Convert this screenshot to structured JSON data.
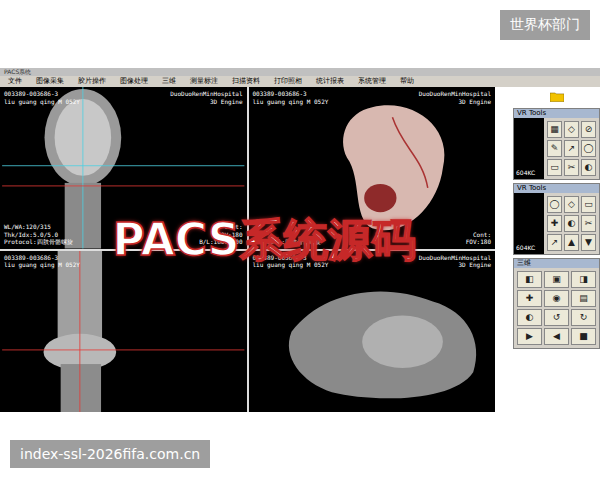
{
  "badge": "世界杯部门",
  "footer_url": "index-ssl-2026fifa.com.cn",
  "overlay_title": "PACS系统源码",
  "window": {
    "title": "PACS系统"
  },
  "menu": [
    "文件",
    "图像采集",
    "胶片操作",
    "图像处理",
    "三维",
    "测量标注",
    "扫描资料",
    "打印照相",
    "统计报表",
    "系统管理",
    "帮助"
  ],
  "viewports": [
    {
      "kind": "coronal",
      "top_left": [
        "003389-003686-3",
        "liu guang qing M 052Y"
      ],
      "top_right": [
        "DuoDuoRenMinHospital",
        "3D Engine"
      ],
      "bottom_left": [
        "WL/WA:120/315",
        "Thk/Idx:5.0/5.0",
        "Protocol:四肢骨骼螺旋"
      ],
      "bottom_right": [
        "Cont:",
        "FOV:180",
        "B/L:1600/300"
      ]
    },
    {
      "kind": "render-color",
      "top_left": [
        "003389-003686-3",
        "liu guang qing M 052Y"
      ],
      "top_right": [
        "DuoDuoRenMinHospital",
        "3D Engine"
      ],
      "bottom_left": [
        "Protocol:四肢骨骼螺旋"
      ],
      "bottom_right": [
        "Cont:",
        "FOV:180"
      ]
    },
    {
      "kind": "sagittal",
      "top_left": [
        "003389-003686-3",
        "liu guang qing M 052Y"
      ],
      "top_right": [],
      "bottom_left": [],
      "bottom_right": []
    },
    {
      "kind": "render-grey",
      "top_left": [
        "003389-003686-3",
        "liu guang qing M 052Y"
      ],
      "top_right": [
        "DuoDuoRenMinHospital",
        "3D Engine"
      ],
      "bottom_left": [],
      "bottom_right": []
    }
  ],
  "tool_panels": [
    {
      "title": "VR Tools",
      "labels": [
        "604KC"
      ],
      "buttons": [
        "▦",
        "◇",
        "⊘",
        "✎",
        "↗",
        "◯",
        "▭",
        "✂",
        "◐"
      ]
    },
    {
      "title": "VR Tools",
      "labels": [
        "604KC"
      ],
      "buttons": [
        "◯",
        "◇",
        "▭",
        "✚",
        "◐",
        "✂",
        "↗",
        "▲",
        "▼"
      ]
    },
    {
      "title": "三维",
      "labels": [],
      "buttons": [
        "◧",
        "▣",
        "◨",
        "✚",
        "◉",
        "▤",
        "◐",
        "↺",
        "↻",
        "▶",
        "◀",
        "■"
      ]
    }
  ]
}
